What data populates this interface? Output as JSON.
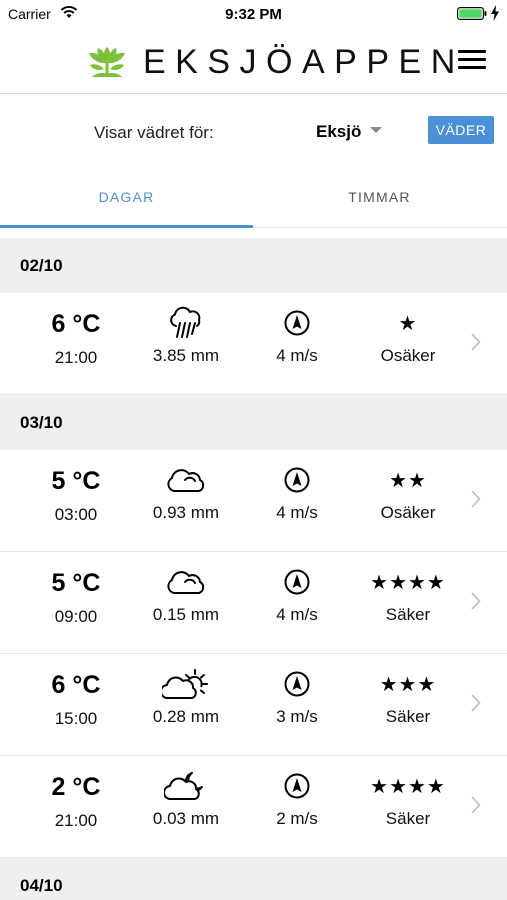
{
  "status_bar": {
    "carrier": "Carrier",
    "time": "9:32 PM"
  },
  "header": {
    "title": "EKSJÖAPPEN"
  },
  "location": {
    "label": "Visar vädret för:",
    "selected": "Eksjö",
    "button_label": "VÄDER"
  },
  "tabs": [
    {
      "label": "DAGAR",
      "active": true
    },
    {
      "label": "TIMMAR",
      "active": false
    }
  ],
  "days": [
    {
      "date": "02/10",
      "rows": [
        {
          "temp": "6 °C",
          "time": "21:00",
          "weather_icon": "rain-cloud-icon",
          "precip": "3.85 mm",
          "wind": "4 m/s",
          "stars": "★",
          "certainty": "Osäker"
        }
      ]
    },
    {
      "date": "03/10",
      "rows": [
        {
          "temp": "5 °C",
          "time": "03:00",
          "weather_icon": "cloud-icon",
          "precip": "0.93 mm",
          "wind": "4 m/s",
          "stars": "★★",
          "certainty": "Osäker"
        },
        {
          "temp": "5 °C",
          "time": "09:00",
          "weather_icon": "cloud-icon",
          "precip": "0.15 mm",
          "wind": "4 m/s",
          "stars": "★★★★",
          "certainty": "Säker"
        },
        {
          "temp": "6 °C",
          "time": "15:00",
          "weather_icon": "partly-sunny-icon",
          "precip": "0.28 mm",
          "wind": "3 m/s",
          "stars": "★★★",
          "certainty": "Säker"
        },
        {
          "temp": "2 °C",
          "time": "21:00",
          "weather_icon": "cloud-moon-icon",
          "precip": "0.03 mm",
          "wind": "2 m/s",
          "stars": "★★★★",
          "certainty": "Säker"
        }
      ]
    },
    {
      "date": "04/10",
      "rows": []
    }
  ],
  "colors": {
    "accent": "#4a90d9",
    "date_header_bg": "#efefef",
    "logo_green": "#7cc13a"
  }
}
